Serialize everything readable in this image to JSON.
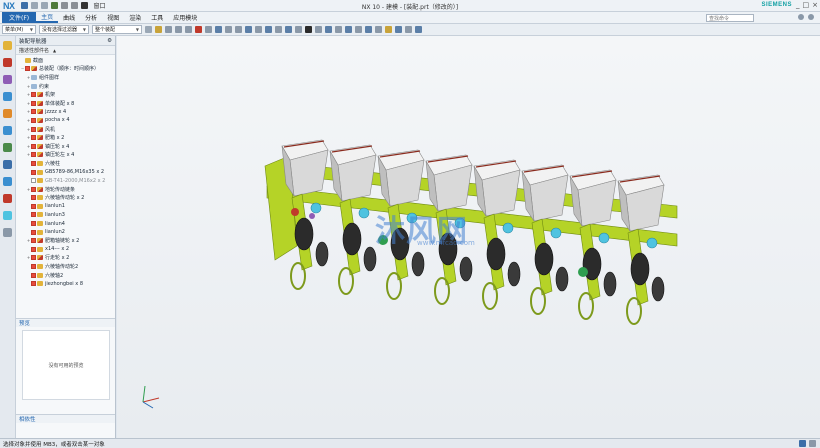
{
  "app": {
    "logo": "NX",
    "window_menu": "窗口",
    "title": "NX 10 - 建模 - [装配.prt（修改的）]",
    "brand": "SIEMENS",
    "controls": [
      "_",
      "□",
      "×"
    ]
  },
  "ribbon": {
    "file_tab": "文件(F)",
    "tabs": [
      "主页",
      "曲线",
      "分析",
      "视图",
      "渲染",
      "工具",
      "应用模块"
    ],
    "search_placeholder": "查找命令"
  },
  "toolbar": {
    "menu_label": "菜单(M)",
    "filter_value": "没有选择过滤器",
    "scope_value": "整个装配"
  },
  "navigator": {
    "title": "装配导航器",
    "column_header": "描述性部件名",
    "items": [
      {
        "label": "截面",
        "level": 0,
        "expand": "",
        "check": "none",
        "icon": "folder"
      },
      {
        "label": "总装配（顺序：时间顺序）",
        "level": 0,
        "expand": "−",
        "check": "on",
        "icon": "asm"
      },
      {
        "label": "组件图样",
        "level": 1,
        "expand": "+",
        "check": "none",
        "icon": "ref"
      },
      {
        "label": "约束",
        "level": 1,
        "expand": "+",
        "check": "none",
        "icon": "ref"
      },
      {
        "label": "机架",
        "level": 1,
        "expand": "+",
        "check": "on",
        "icon": "asm"
      },
      {
        "label": "单体装配 x 8",
        "level": 1,
        "expand": "+",
        "check": "on",
        "icon": "asm"
      },
      {
        "label": "jzzzz x 4",
        "level": 1,
        "expand": "+",
        "check": "on",
        "icon": "asm"
      },
      {
        "label": "pocha x 4",
        "level": 1,
        "expand": "+",
        "check": "on",
        "icon": "asm"
      },
      {
        "label": "风机",
        "level": 1,
        "expand": "+",
        "check": "on",
        "icon": "asm"
      },
      {
        "label": "肥箱 x 2",
        "level": 1,
        "expand": "+",
        "check": "on",
        "icon": "asm"
      },
      {
        "label": "镇压轮 x 4",
        "level": 1,
        "expand": "+",
        "check": "on",
        "icon": "asm"
      },
      {
        "label": "镇压轮左 x 4",
        "level": 1,
        "expand": "+",
        "check": "on",
        "icon": "asm"
      },
      {
        "label": "六棱柱",
        "level": 1,
        "expand": "",
        "check": "on",
        "icon": "part"
      },
      {
        "label": "GB5789-86,M16x35 x 2",
        "level": 1,
        "expand": "",
        "check": "on",
        "icon": "part"
      },
      {
        "label": "GB-T41-2000,M16x2 x 2",
        "level": 1,
        "expand": "",
        "check": "off",
        "icon": "part",
        "gray": true
      },
      {
        "label": "地轮传动链条",
        "level": 1,
        "expand": "+",
        "check": "on",
        "icon": "asm"
      },
      {
        "label": "六棱轴传动轮 x 2",
        "level": 1,
        "expand": "",
        "check": "on",
        "icon": "part"
      },
      {
        "label": "lianlun1",
        "level": 1,
        "expand": "",
        "check": "on",
        "icon": "part"
      },
      {
        "label": "lianlun3",
        "level": 1,
        "expand": "",
        "check": "on",
        "icon": "part"
      },
      {
        "label": "lianlun4",
        "level": 1,
        "expand": "",
        "check": "on",
        "icon": "part"
      },
      {
        "label": "lianlun2",
        "level": 1,
        "expand": "",
        "check": "on",
        "icon": "part"
      },
      {
        "label": "肥箱轴链轮 x 2",
        "level": 1,
        "expand": "+",
        "check": "on",
        "icon": "asm"
      },
      {
        "label": "x14--- x 2",
        "level": 1,
        "expand": "",
        "check": "on",
        "icon": "part"
      },
      {
        "label": "行走轮 x 2",
        "level": 1,
        "expand": "+",
        "check": "on",
        "icon": "asm"
      },
      {
        "label": "六棱轴传动轮2",
        "level": 1,
        "expand": "",
        "check": "on",
        "icon": "part"
      },
      {
        "label": "六棱轴2",
        "level": 1,
        "expand": "",
        "check": "on",
        "icon": "part"
      },
      {
        "label": "jiezhongbei x 8",
        "level": 1,
        "expand": "",
        "check": "on",
        "icon": "part"
      }
    ],
    "preview_title": "预览",
    "preview_empty": "没有可用的预览",
    "dependency_title": "相依性"
  },
  "graphics": {
    "watermark": "沐风网",
    "watermark_url": "www.mfcad.com",
    "row_units": 8
  },
  "status": {
    "text": "选择对象并使用 MB3，或者双击某一对象"
  },
  "colors": {
    "accent": "#2467b0",
    "frame_green": "#b5d327",
    "hopper_white": "#f2f2f2",
    "disc_dark": "#2b2b2b",
    "cyan_parts": "#4fc3e0"
  }
}
